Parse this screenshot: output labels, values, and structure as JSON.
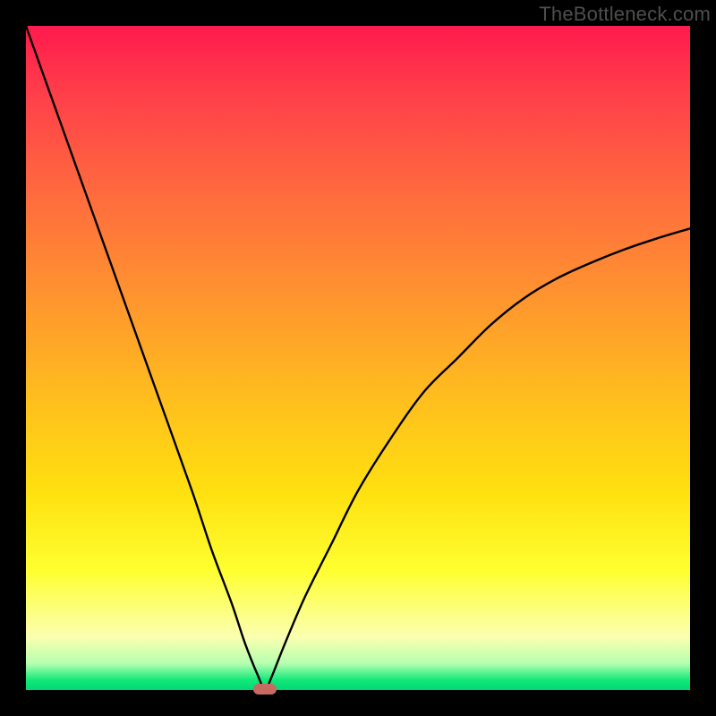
{
  "watermark": "TheBottleneck.com",
  "colors": {
    "frame": "#000000",
    "curve": "#000000",
    "marker": "#c76a62",
    "gradient_top": "#ff1a4d",
    "gradient_bottom": "#00d873"
  },
  "chart_data": {
    "type": "line",
    "title": "",
    "xlabel": "",
    "ylabel": "",
    "xlim": [
      0,
      100
    ],
    "ylim": [
      0,
      100
    ],
    "optimum_x": 36,
    "series": [
      {
        "name": "bottleneck-curve",
        "x": [
          0,
          5,
          10,
          15,
          20,
          25,
          28,
          31,
          33,
          35,
          36,
          37,
          39,
          42,
          46,
          50,
          55,
          60,
          65,
          70,
          75,
          80,
          85,
          90,
          95,
          100
        ],
        "values": [
          100,
          86,
          72,
          58,
          44,
          30,
          21,
          13,
          7,
          2,
          0,
          2,
          7,
          14,
          22,
          30,
          38,
          45,
          50,
          55,
          59,
          62,
          64.3,
          66.3,
          68,
          69.5
        ]
      }
    ],
    "marker": {
      "x": 36,
      "y": 0,
      "shape": "rounded-rect"
    }
  }
}
